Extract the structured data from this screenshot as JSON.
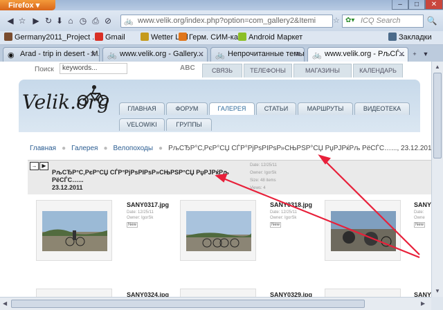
{
  "browser": {
    "app_button": "Firefox",
    "url": "www.velik.org/index.php?option=com_gallery2&Itemi",
    "search_placeholder": "ICQ Search",
    "bookmarks": [
      {
        "label": "Germany2011_Project ...",
        "icon_color": "#7a4d2f"
      },
      {
        "label": "Gmail",
        "icon_color": "#d93025"
      },
      {
        "label": "Wetter Lod",
        "icon_color": "#c59a1c"
      },
      {
        "label": "Герм. СИМ-ка",
        "icon_color": "#e0761b"
      },
      {
        "label": "Android Маркет",
        "icon_color": "#8cbf26"
      }
    ],
    "bookmarks_menu": "Закладки",
    "tabs": [
      {
        "label": "Arad - trip in desert - M...",
        "icon": "map-icon"
      },
      {
        "label": "www.velik.org - Gallery...",
        "icon": "bike-icon"
      },
      {
        "label": "Непрочитанные темы",
        "icon": "bike-icon"
      },
      {
        "label": "www.velik.org - РљСЃ...",
        "icon": "bike-icon"
      }
    ]
  },
  "site": {
    "search_label": "Поиск",
    "search_value": "keywords...",
    "abc": "ABC",
    "top_tabs": [
      "СВЯЗЬ",
      "ТЕЛЕФОНЫ",
      "МАГАЗИНЫ",
      "КАЛЕНДАРЬ"
    ],
    "logo": "Velik.org",
    "main_tabs": [
      "ГЛАВНАЯ",
      "ФОРУМ",
      "ГАЛЕРЕЯ",
      "СТАТЬИ",
      "МАРШРУТЫ",
      "ВИДЕОТЕКА"
    ],
    "sub_tabs": [
      "VELOWIKI",
      "ГРУППЫ"
    ],
    "active_tab": "ГАЛЕРЕЯ",
    "breadcrumb": {
      "home": "Главная",
      "gallery": "Галерея",
      "rides": "Велопоходы",
      "current": "РљСЂР°С‚РєР°СЏ СЃР°РјРѕРІРѕР»СЊРЅР°СЏ РџРЈРќРљ РёСЃС…..., 23.12.2011"
    },
    "album": {
      "title_line1": "РљСЂР°С‚РєР°СЏ СЃР°РјРѕРІРѕР»СЊРЅР°СЏ РџРЈРќРљ РёСЃС…...",
      "title_line2": "23.12.2011",
      "date": "Date: 12/25/11",
      "owner": "Owner: IgorSk",
      "size": "Size: 48 items",
      "views": "Views: 4"
    },
    "cards": [
      {
        "title": "SANY0317.jpg",
        "date": "Date: 12/25/11",
        "owner": "Owner: IgorSk",
        "badge": "New"
      },
      {
        "title": "SANY0318.jpg",
        "date": "Date: 12/25/11",
        "owner": "Owner: IgorSk",
        "badge": "New"
      },
      {
        "title": "SANY",
        "date": "Date:",
        "owner": "Owne",
        "badge": "New"
      }
    ],
    "row2_titles": [
      "SANY0324.jpg",
      "SANY0329.jpg",
      "SANY"
    ]
  },
  "colors": {
    "annotation_arrow": "#e8203a",
    "accent": "#2f6b9c"
  }
}
